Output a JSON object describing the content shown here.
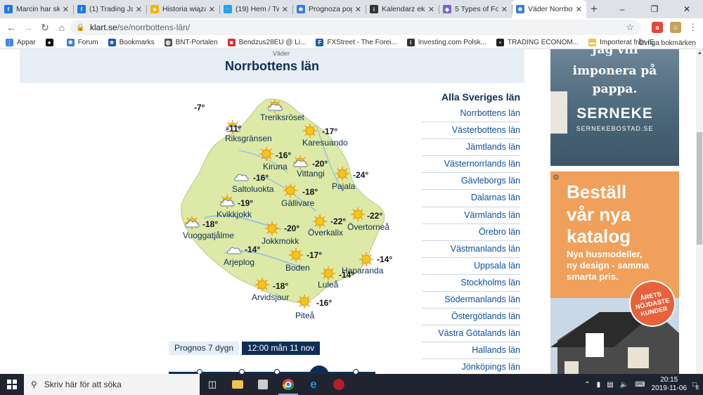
{
  "browser": {
    "tabs": [
      {
        "label": "Marcin har sk",
        "icon": "facebook-icon",
        "color": "#1877f2",
        "glyph": "f"
      },
      {
        "label": "(1) Trading Jan",
        "icon": "facebook-icon",
        "color": "#1877f2",
        "glyph": "f"
      },
      {
        "label": "Historia wiązań",
        "icon": "bookmark-yellow-icon",
        "color": "#f2b600",
        "glyph": "■"
      },
      {
        "label": "(19) Hem / Twi",
        "icon": "twitter-icon",
        "color": "#1da1f2",
        "glyph": "🐦"
      },
      {
        "label": "Prognoza pogo",
        "icon": "snowflake-icon",
        "color": "#3b7dd8",
        "glyph": "❄"
      },
      {
        "label": "Kalendarz ekon",
        "icon": "investing-icon",
        "color": "#333333",
        "glyph": "i"
      },
      {
        "label": "5 Types of For",
        "icon": "diamond-icon",
        "color": "#7a5fd1",
        "glyph": "◆"
      },
      {
        "label": "Väder Norrbott",
        "icon": "snowflake-icon",
        "color": "#3b7dd8",
        "glyph": "❄"
      }
    ],
    "url_host": "klart.se",
    "url_path": "/se/norrbottens-län/",
    "bookmarks": [
      {
        "label": "Appar",
        "icon": "apps-grid-icon"
      },
      {
        "label": "",
        "icon": "github-icon"
      },
      {
        "label": "Forum",
        "icon": "snowflake-icon"
      },
      {
        "label": "Bookmarks",
        "icon": "star-icon"
      },
      {
        "label": "BNT-Portalen",
        "icon": "globe-icon"
      },
      {
        "label": "Bendzus28EU @ Li...",
        "icon": "red-square-icon"
      },
      {
        "label": "FXStreet - The Forei...",
        "icon": "fxstreet-icon"
      },
      {
        "label": "Investing.com Polsk...",
        "icon": "investing-icon"
      },
      {
        "label": "TRADING ECONOM...",
        "icon": "tradingeconomics-icon"
      },
      {
        "label": "Importerat från IE",
        "icon": "folder-icon"
      }
    ],
    "bookmarks_other": "Övriga bokmärken"
  },
  "page": {
    "header_small": "Väder",
    "header_title": "Norrbottens län",
    "cities": [
      {
        "name": "Treriksröset",
        "temp": "-7°",
        "weather": "sun-cloud"
      },
      {
        "name": "Riksgränsen",
        "temp": "-11°",
        "weather": "sun-cloud"
      },
      {
        "name": "Karesuando",
        "temp": "-17°",
        "weather": "sun"
      },
      {
        "name": "Kiruna",
        "temp": "-16°",
        "weather": "sun"
      },
      {
        "name": "Vittangi",
        "temp": "-20°",
        "weather": "sun-cloud"
      },
      {
        "name": "Pajala",
        "temp": "-24°",
        "weather": "sun"
      },
      {
        "name": "Saltoluokta",
        "temp": "-16°",
        "weather": "cloud"
      },
      {
        "name": "Gällivare",
        "temp": "-18°",
        "weather": "sun"
      },
      {
        "name": "Kvikkjokk",
        "temp": "-19°",
        "weather": "sun-cloud"
      },
      {
        "name": "Övertorneå",
        "temp": "-22°",
        "weather": "sun"
      },
      {
        "name": "Vuoggatjålme",
        "temp": "-18°",
        "weather": "sun-cloud"
      },
      {
        "name": "Jokkmokk",
        "temp": "-20°",
        "weather": "sun"
      },
      {
        "name": "Överkalix",
        "temp": "-22°",
        "weather": "sun"
      },
      {
        "name": "Arjeplog",
        "temp": "-14°",
        "weather": "cloud"
      },
      {
        "name": "Boden",
        "temp": "-17°",
        "weather": "sun"
      },
      {
        "name": "Haparanda",
        "temp": "-14°",
        "weather": "sun"
      },
      {
        "name": "Luleå",
        "temp": "-14°",
        "weather": "sun"
      },
      {
        "name": "Arvidsjaur",
        "temp": "-18°",
        "weather": "sun"
      },
      {
        "name": "Piteå",
        "temp": "-16°",
        "weather": "sun"
      }
    ],
    "lan_title": "Alla Sveriges län",
    "lan": [
      "Norrbottens län",
      "Västerbottens län",
      "Jämtlands län",
      "Västernorrlands län",
      "Gävleborgs län",
      "Dalarnas län",
      "Värmlands län",
      "Örebro län",
      "Västmanlands län",
      "Uppsala län",
      "Stockholms län",
      "Södermanlands län",
      "Östergötlands län",
      "Västra Götalands län",
      "Hallands län",
      "Jönköpings län"
    ],
    "prognos_label": "Prognos 7 dygn",
    "prognos_time": "12:00 mån 11 nov"
  },
  "ads": {
    "ad1_line1": "Jag vill",
    "ad1_line2": "imponera på",
    "ad1_line3": "pappa.",
    "ad1_brand": "SERNEKE",
    "ad1_site": "SERNEKEBOSTAD.SE",
    "ad2_head1": "Beställ",
    "ad2_head2": "vår nya",
    "ad2_head3": "katalog",
    "ad2_sub1": "Nya husmodeller,",
    "ad2_sub2": "ny design - samma",
    "ad2_sub3": "smarta pris.",
    "ad2_badge": "ÅRETS NÖJDASTE KUNDER"
  },
  "taskbar": {
    "search_placeholder": "Skriv här för att söka",
    "time": "20:15",
    "date": "2019-11-06",
    "notifications": "8"
  }
}
